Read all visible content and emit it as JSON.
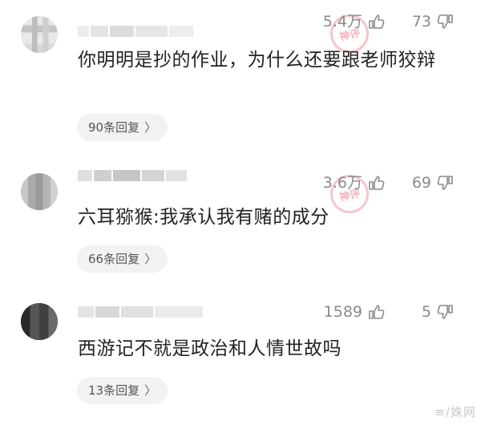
{
  "comments": [
    {
      "likes": "5.4万",
      "dislikes": "73",
      "text": "你明明是抄的作业，为什么还要跟老师狡辩",
      "replies": "90条回复"
    },
    {
      "likes": "3.6万",
      "dislikes": "69",
      "text": "六耳猕猴:我承认我有赌的成分",
      "replies": "66条回复"
    },
    {
      "likes": "1589",
      "dislikes": "5",
      "text": "西游记不就是政治和人情世故吗",
      "replies": "13条回复"
    }
  ],
  "icons": {
    "like": "thumbs-up-icon",
    "dislike": "thumbs-down-icon",
    "chevron": "chevron-right-icon"
  },
  "colors": {
    "text": "#222222",
    "meta": "#8a8a8a",
    "pill_bg": "#f2f2f2",
    "stamp": "#e15a6e"
  }
}
